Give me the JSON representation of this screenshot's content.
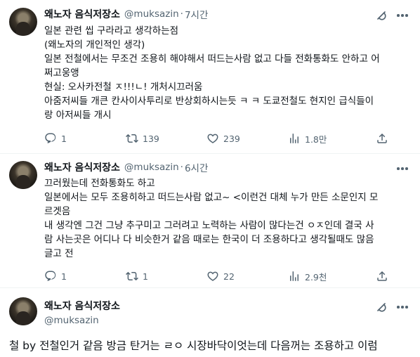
{
  "tweets": [
    {
      "name": "왜노자 음식저장소",
      "handle": "@muksazin",
      "time": "7시간",
      "lines": [
        "일본 관련 씹 구라라고 생각하는점",
        "(왜노자의 개인적인 생각)",
        "일본 전철에서는 무조건 조용히 해야해서 떠드는사람 없고 다들 전화통화도 안하고 어",
        "쩌고웅앵",
        "현실: 오사카전철 ㅈ!!!ㄴ! 개처시끄러움",
        "아줌저씨들 개큰 칸사이사투리로 반상회하시는듯 ㅋ ㅋ 도쿄전철도 현지인 급식들이",
        "랑 아저씨들 개시"
      ],
      "replies": "1",
      "retweets": "139",
      "likes": "239",
      "views": "1.8만"
    },
    {
      "name": "왜노자 음식저장소",
      "handle": "@muksazin",
      "time": "6시간",
      "lines": [
        "끄러웠는데 전화통화도 하고",
        "일본에서는 모두 조용히하고 떠드는사람 없고~ <이런건 대체 누가 만든 소문인지 모",
        "르겟음",
        "내 생각엔 그건 그냥 추구미고 그러려고 노력하는 사람이 많다는건 ㅇㅈ인데 결국 사",
        "람 사는곳은 어디나 다 비슷한거 같음 때로는 한국이 더 조용하다고 생각될때도 많음",
        "글고 전"
      ],
      "replies": "1",
      "retweets": "1",
      "likes": "22",
      "views": "2.9천"
    }
  ],
  "focused": {
    "name": "왜노자 음식저장소",
    "handle": "@muksazin",
    "text": "철 by 전철인거 같음 방금 탄거는 ㄹㅇ 시장바닥이엇는데 다음꺼는 조용하고 이럼"
  },
  "icons": {
    "reply": "reply-icon",
    "retweet": "retweet-icon",
    "like": "heart-icon",
    "views": "views-icon",
    "share": "share-icon",
    "grok": "grok-icon",
    "more": "more-icon"
  }
}
